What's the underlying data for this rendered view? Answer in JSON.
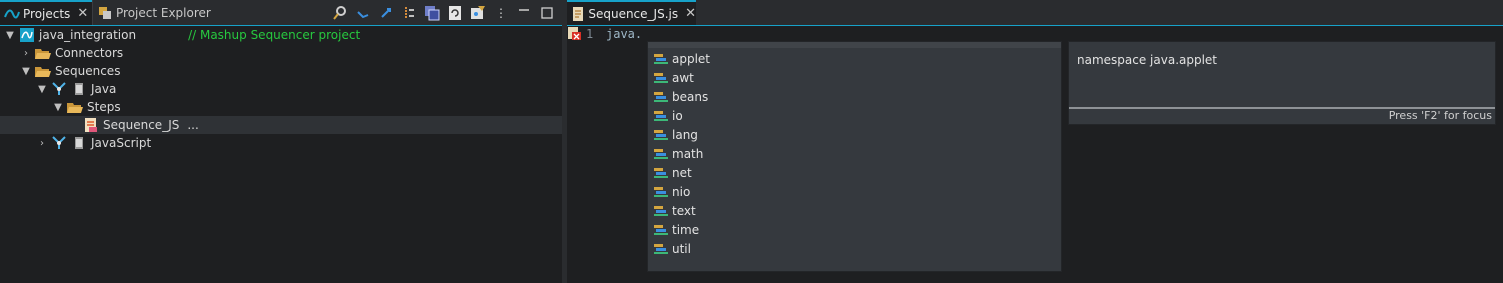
{
  "left_panel": {
    "tabs": [
      {
        "label": "Projects",
        "icon": "projects-wave-icon",
        "active": true
      },
      {
        "label": "Project Explorer",
        "icon": "project-explorer-icon",
        "active": false
      }
    ],
    "toolbar_icons": [
      "search-icon",
      "sync-icon",
      "link-icon",
      "sort-icon",
      "collapse-all-icon",
      "refresh-icon",
      "filter-icon",
      "more-icon",
      "minimize-icon",
      "maximize-icon"
    ],
    "tree": {
      "project": {
        "label": "java_integration",
        "comment": "// Mashup Sequencer project"
      },
      "connectors": {
        "label": "Connectors"
      },
      "sequences": {
        "label": "Sequences"
      },
      "java": {
        "label": "Java"
      },
      "steps": {
        "label": "Steps"
      },
      "sequence_js": {
        "label": "Sequence_JS",
        "suffix": "..."
      },
      "javascript": {
        "label": "JavaScript"
      }
    }
  },
  "editor": {
    "tab": {
      "label": "Sequence_JS.js"
    },
    "line_number": "1",
    "code": "java.",
    "completion_items": [
      {
        "label": "applet"
      },
      {
        "label": "awt"
      },
      {
        "label": "beans"
      },
      {
        "label": "io"
      },
      {
        "label": "lang"
      },
      {
        "label": "math"
      },
      {
        "label": "net"
      },
      {
        "label": "nio"
      },
      {
        "label": "text"
      },
      {
        "label": "time"
      },
      {
        "label": "util"
      }
    ],
    "info": {
      "text": "namespace java.applet",
      "hint": "Press 'F2' for focus"
    }
  },
  "colors": {
    "accent": "#17a2c9",
    "comment": "#27c93f",
    "background": "#1e1f21",
    "popup": "#35393e"
  }
}
